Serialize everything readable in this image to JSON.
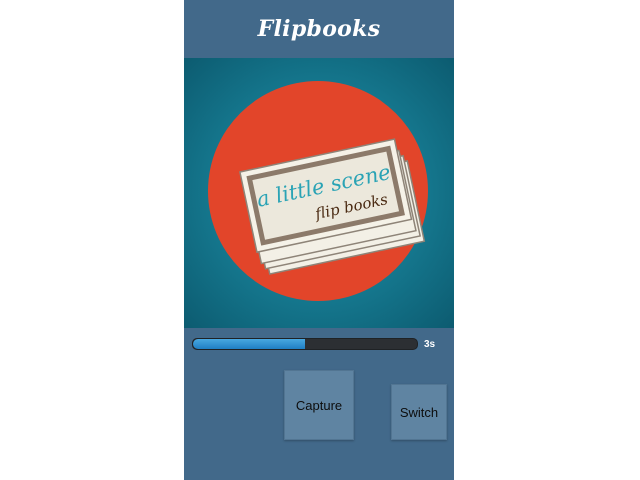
{
  "app": {
    "title": "Flipbooks"
  },
  "preview": {
    "logo_line1": "a little scene",
    "logo_line2": "flip books",
    "colors": {
      "circle": "#e2452a",
      "background": "#177e95",
      "line1": "#2aa3b5",
      "line2": "#4a2a12"
    }
  },
  "recording": {
    "progress": 0.5,
    "timer_label": "3s"
  },
  "controls": {
    "capture_label": "Capture",
    "switch_label": "Switch"
  }
}
